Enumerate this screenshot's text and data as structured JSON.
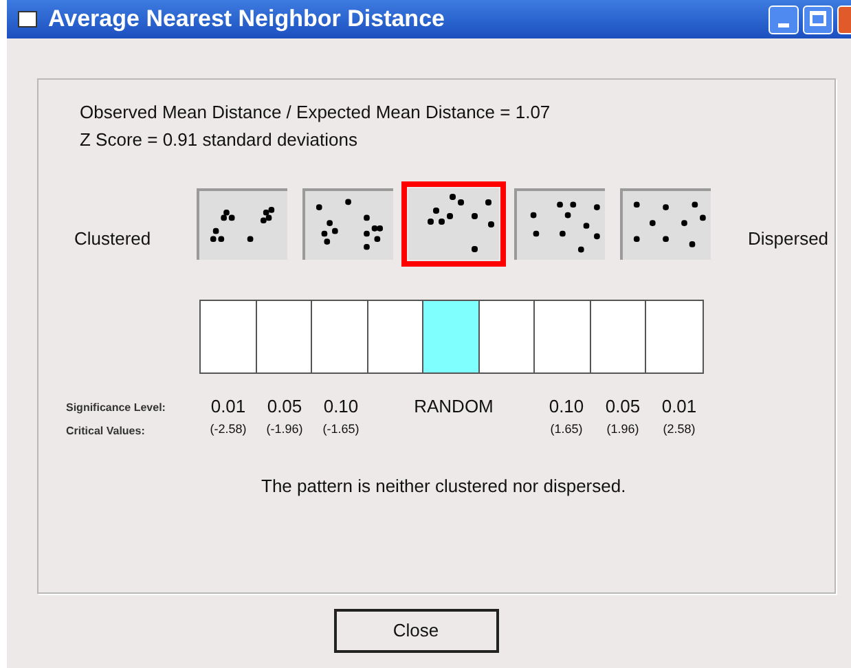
{
  "window": {
    "title": "Average Nearest Neighbor Distance"
  },
  "summary": [
    "Observed Mean Distance / Expected Mean Distance = 1.07",
    "Z Score = 0.91 standard deviations"
  ],
  "pattern_scale": {
    "left_label": "Clustered",
    "right_label": "Dispersed",
    "patterns": [
      {
        "selected": false
      },
      {
        "selected": false
      },
      {
        "selected": true
      },
      {
        "selected": false
      },
      {
        "selected": false
      }
    ]
  },
  "bar": {
    "cells": [
      {
        "selected": false
      },
      {
        "selected": false
      },
      {
        "selected": false
      },
      {
        "selected": false
      },
      {
        "selected": true
      },
      {
        "selected": false
      },
      {
        "selected": false
      },
      {
        "selected": false
      },
      {
        "selected": false
      }
    ]
  },
  "significance": {
    "row_labels": [
      "Significance Level:",
      "Critical Values:"
    ],
    "columns": [
      {
        "significance": "0.01",
        "critical": "(-2.58)"
      },
      {
        "significance": "0.05",
        "critical": "(-1.96)"
      },
      {
        "significance": "0.10",
        "critical": "(-1.65)"
      },
      {
        "significance": "RANDOM"
      },
      {
        "significance": "0.10",
        "critical": "(1.65)"
      },
      {
        "significance": "0.05",
        "critical": "(1.96)"
      },
      {
        "significance": "0.01",
        "critical": "(2.58)"
      }
    ]
  },
  "message": "The pattern is neither clustered nor dispersed.",
  "buttons": [
    "Close"
  ]
}
